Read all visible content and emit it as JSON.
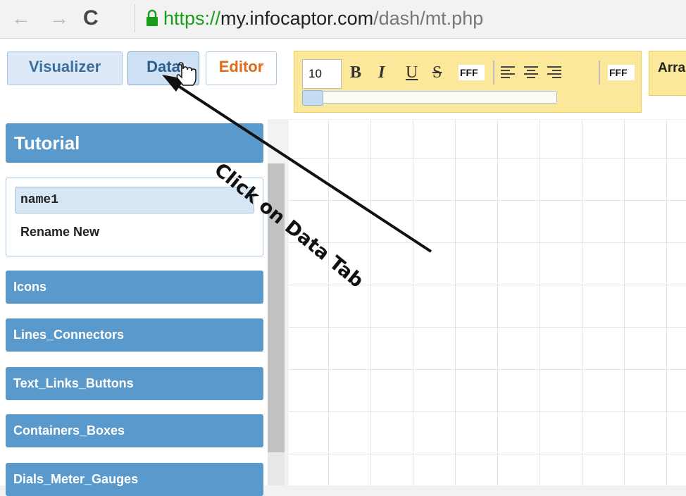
{
  "browser": {
    "url_scheme": "https://",
    "url_host": "my.infocaptor.com",
    "url_path": "/dash/mt.php"
  },
  "tabs": [
    {
      "label": "Visualizer"
    },
    {
      "label": "Data"
    },
    {
      "label": "Editor"
    }
  ],
  "toolbar": {
    "font_size": "10",
    "bold": "B",
    "italic": "I",
    "underline": "U",
    "strike": "S",
    "fg_color": "FFF",
    "bg_color": "FFF",
    "arrange_label": "Arra"
  },
  "sidebar": {
    "title": "Tutorial",
    "dashboard_name": "name1",
    "rename_label": "Rename New",
    "categories": [
      {
        "label": "Icons"
      },
      {
        "label": "Lines_Connectors"
      },
      {
        "label": "Text_Links_Buttons"
      },
      {
        "label": "Containers_Boxes"
      },
      {
        "label": "Dials_Meter_Gauges"
      }
    ]
  },
  "annotation": {
    "text": "Click on Data Tab"
  }
}
